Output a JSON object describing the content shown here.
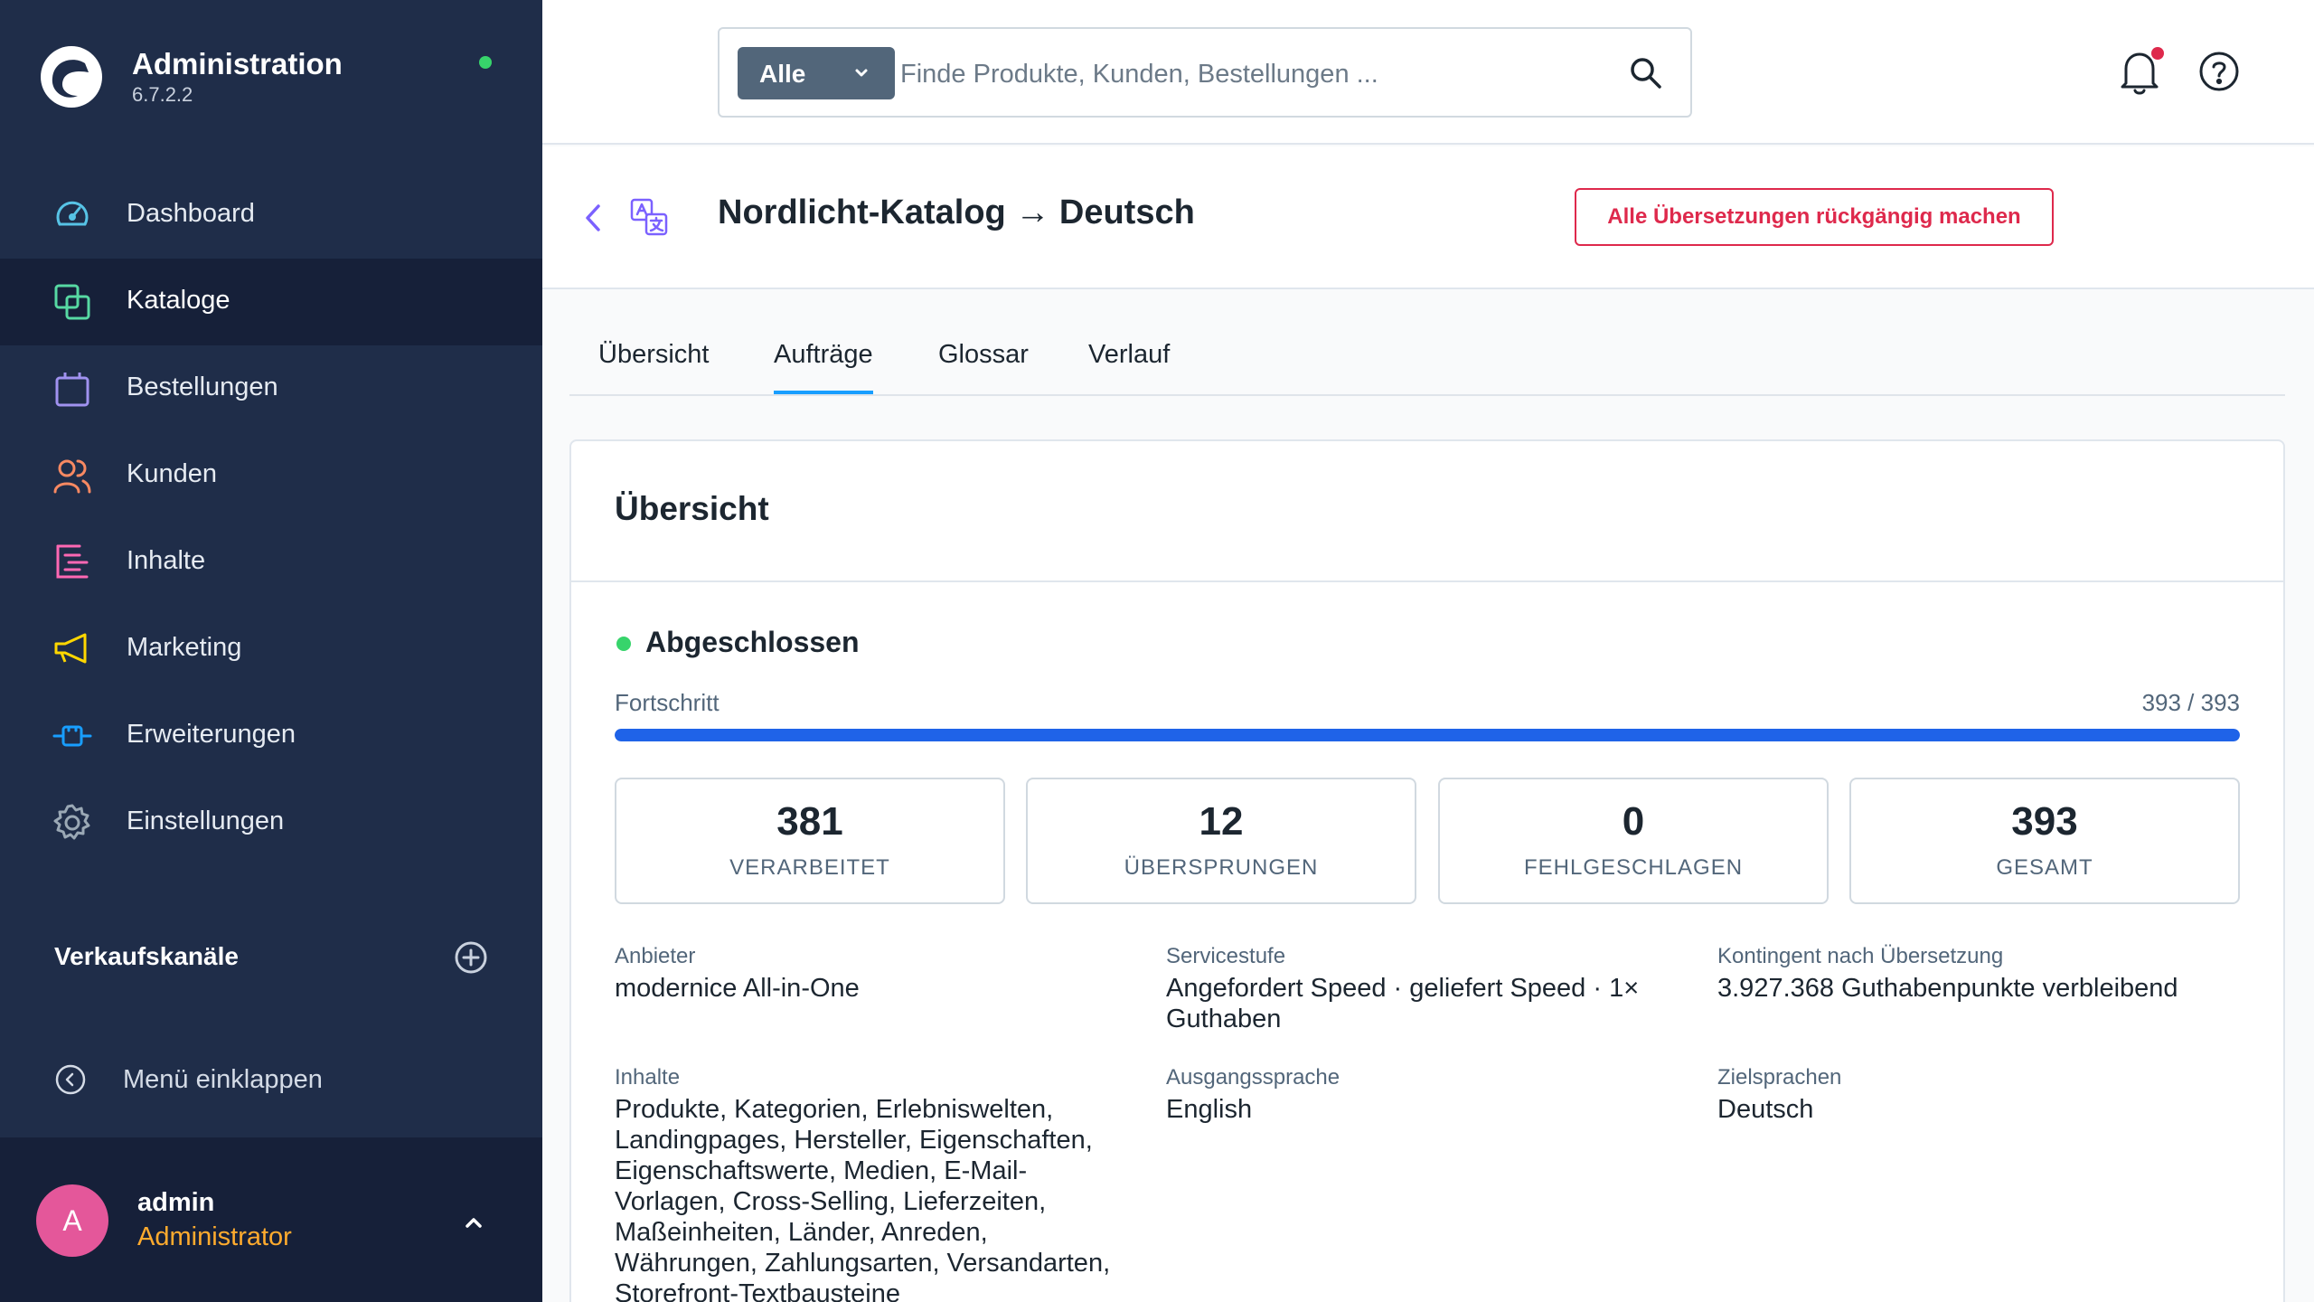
{
  "app": {
    "title": "Administration",
    "version": "6.7.2.2",
    "status_color": "#37d46b"
  },
  "sidebar": {
    "items": [
      {
        "label": "Dashboard",
        "icon": "dashboard-gauge-icon",
        "color": "#57c3e6"
      },
      {
        "label": "Kataloge",
        "icon": "catalog-icon",
        "color": "#57d9a3"
      },
      {
        "label": "Bestellungen",
        "icon": "shopping-bag-icon",
        "color": "#a092f0"
      },
      {
        "label": "Kunden",
        "icon": "customers-icon",
        "color": "#f88962"
      },
      {
        "label": "Inhalte",
        "icon": "content-list-icon",
        "color": "#ff68b4"
      },
      {
        "label": "Marketing",
        "icon": "megaphone-icon",
        "color": "#ffd700"
      },
      {
        "label": "Erweiterungen",
        "icon": "plugin-icon",
        "color": "#189eff"
      },
      {
        "label": "Einstellungen",
        "icon": "gear-icon",
        "color": "#9aa8b5"
      }
    ],
    "active_index": 1,
    "sales_channels_title": "Verkaufskanäle",
    "collapse_label": "Menü einklappen"
  },
  "user": {
    "initial": "A",
    "name": "admin",
    "role": "Administrator"
  },
  "search": {
    "type_label": "Alle",
    "placeholder": "Finde Produkte, Kunden, Bestellungen ..."
  },
  "header": {
    "title": "Nordlicht-Katalog → Deutsch",
    "revert_button": "Alle Übersetzungen rückgängig machen"
  },
  "tabs": [
    {
      "label": "Übersicht"
    },
    {
      "label": "Aufträge"
    },
    {
      "label": "Glossar"
    },
    {
      "label": "Verlauf"
    }
  ],
  "active_tab": 1,
  "overview": {
    "card_title": "Übersicht",
    "status": "Abgeschlossen",
    "progress_label": "Fortschritt",
    "progress_text": "393 / 393",
    "progress_fraction": 1.0,
    "stats": [
      {
        "value": "381",
        "label": "VERARBEITET"
      },
      {
        "value": "12",
        "label": "ÜBERSPRUNGEN"
      },
      {
        "value": "0",
        "label": "FEHLGESCHLAGEN"
      },
      {
        "value": "393",
        "label": "GESAMT"
      }
    ],
    "details": {
      "provider": {
        "label": "Anbieter",
        "value": "modernice All-in-One"
      },
      "service_level": {
        "label": "Servicestufe",
        "value": "Angefordert Speed · geliefert Speed · 1× Guthaben"
      },
      "quota": {
        "label": "Kontingent nach Übersetzung",
        "value": "3.927.368 Guthabenpunkte verbleibend"
      },
      "contents": {
        "label": "Inhalte",
        "value": "Produkte, Kategorien, Erlebniswelten, Landingpages, Hersteller, Eigenschaften, Eigenschaftswerte, Medien, E-Mail-Vorlagen, Cross-Selling, Lieferzeiten, Maßeinheiten, Länder, Anreden, Währungen, Zahlungsarten, Versandarten, Storefront-Textbausteine"
      },
      "source_language": {
        "label": "Ausgangssprache",
        "value": "English"
      },
      "target_languages": {
        "label": "Zielsprachen",
        "value": "Deutsch"
      }
    }
  }
}
